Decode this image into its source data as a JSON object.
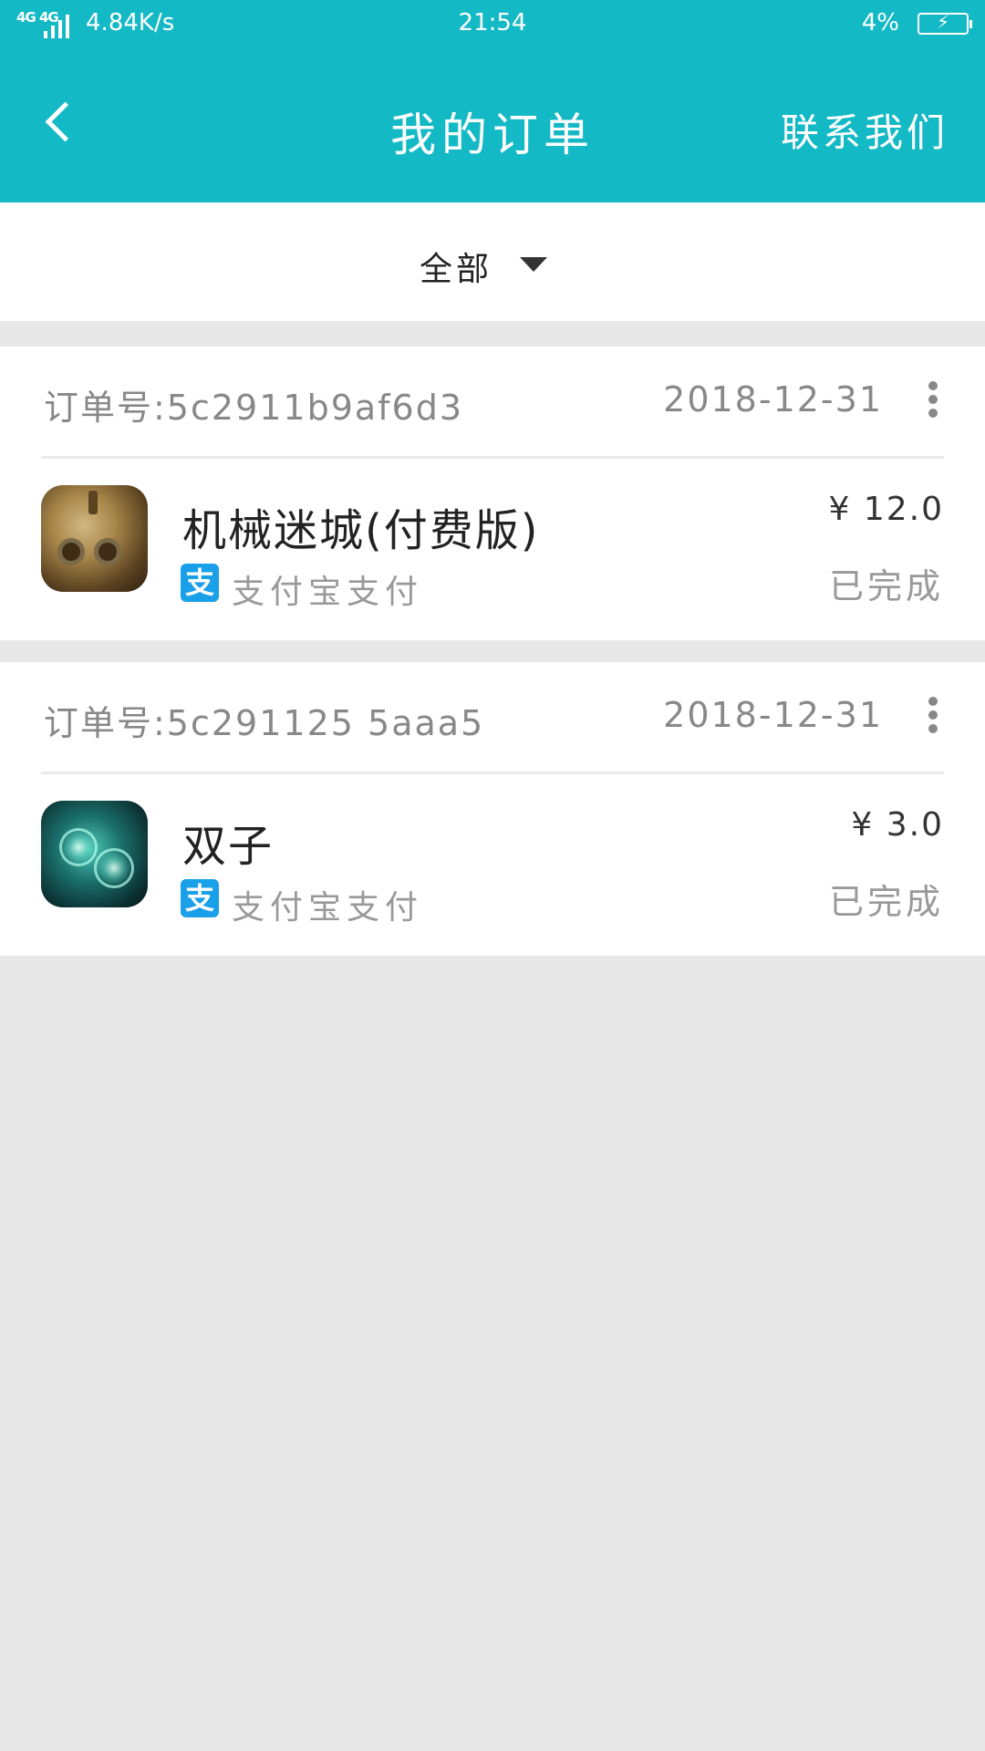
{
  "status_bar": {
    "signal": "4G 4G",
    "net_speed": "4.84K/s",
    "time": "21:54",
    "battery_pct": "4%"
  },
  "header": {
    "title": "我的订单",
    "contact": "联系我们"
  },
  "filter": {
    "label": "全部"
  },
  "orders": [
    {
      "order_no": "订单号:5c2911b9af6d3",
      "date": "2018-12-31",
      "name": "机械迷城(付费版)",
      "pay_icon_glyph": "支",
      "pay_method": "支付宝支付",
      "price": "¥ 12.0",
      "status": "已完成"
    },
    {
      "order_no": "订单号:5c291125 5aaa5",
      "date": "2018-12-31",
      "name": "双子",
      "pay_icon_glyph": "支",
      "pay_method": "支付宝支付",
      "price": "¥ 3.0",
      "status": "已完成"
    }
  ],
  "colors": {
    "accent": "#14b9c6",
    "alipay": "#1aa0e8",
    "background": "#e8e8e8"
  }
}
